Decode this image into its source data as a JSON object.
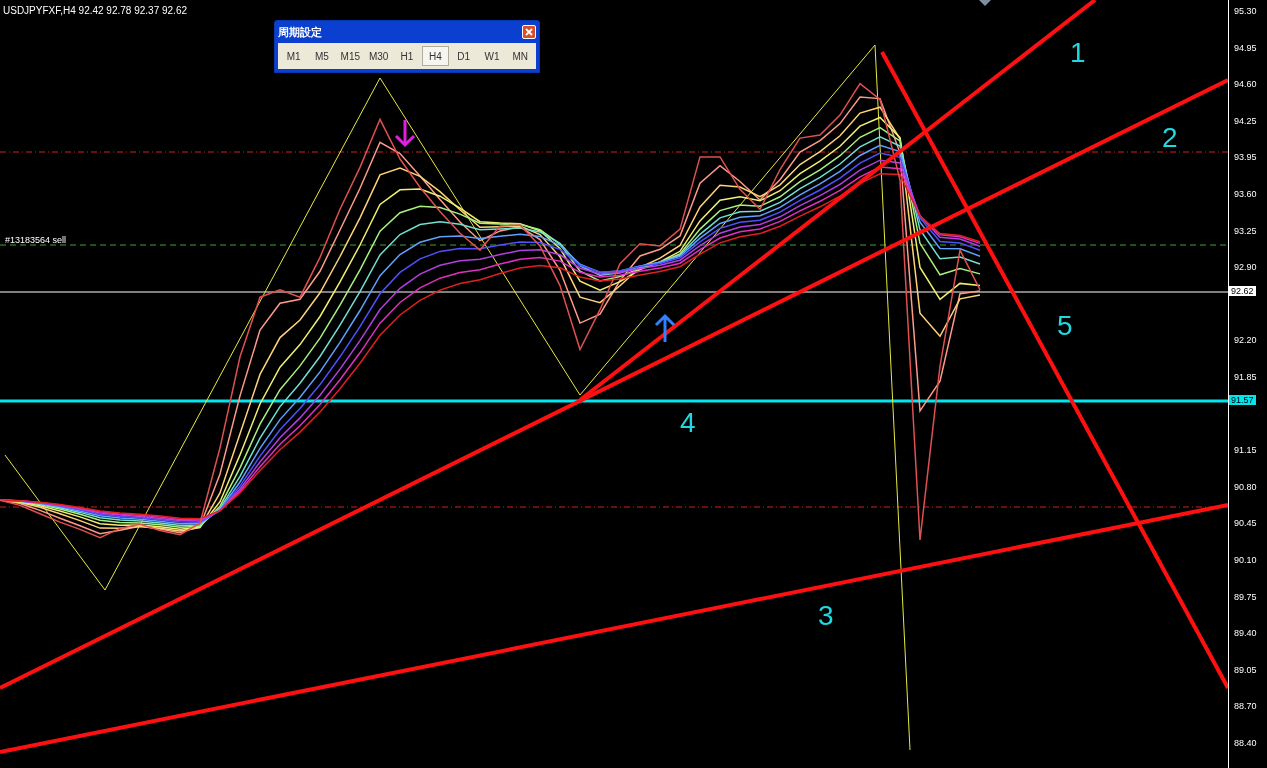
{
  "chart": {
    "header": "USDJPYFXF,H4  92.42 92.78 92.37 92.62",
    "order_label": "#13183564 sell",
    "line_labels": [
      "1",
      "2",
      "3",
      "4",
      "5"
    ],
    "price_axis": [
      "95.30",
      "94.95",
      "94.60",
      "94.25",
      "93.95",
      "93.60",
      "93.25",
      "92.90",
      "92.20",
      "91.85",
      "91.15",
      "90.80",
      "90.45",
      "90.10",
      "89.75",
      "89.40",
      "89.05",
      "88.70",
      "88.40"
    ],
    "price_markers": [
      {
        "text": "92.62",
        "color": "#ffffff"
      },
      {
        "text": "91.57",
        "color": "#00e5ee"
      }
    ]
  },
  "period_dialog": {
    "title": "周期設定",
    "buttons": [
      {
        "label": "M1",
        "selected": false
      },
      {
        "label": "M5",
        "selected": false
      },
      {
        "label": "M15",
        "selected": false
      },
      {
        "label": "M30",
        "selected": false
      },
      {
        "label": "H1",
        "selected": false
      },
      {
        "label": "H4",
        "selected": true
      },
      {
        "label": "D1",
        "selected": false
      },
      {
        "label": "W1",
        "selected": false
      },
      {
        "label": "MN",
        "selected": false
      }
    ]
  }
}
